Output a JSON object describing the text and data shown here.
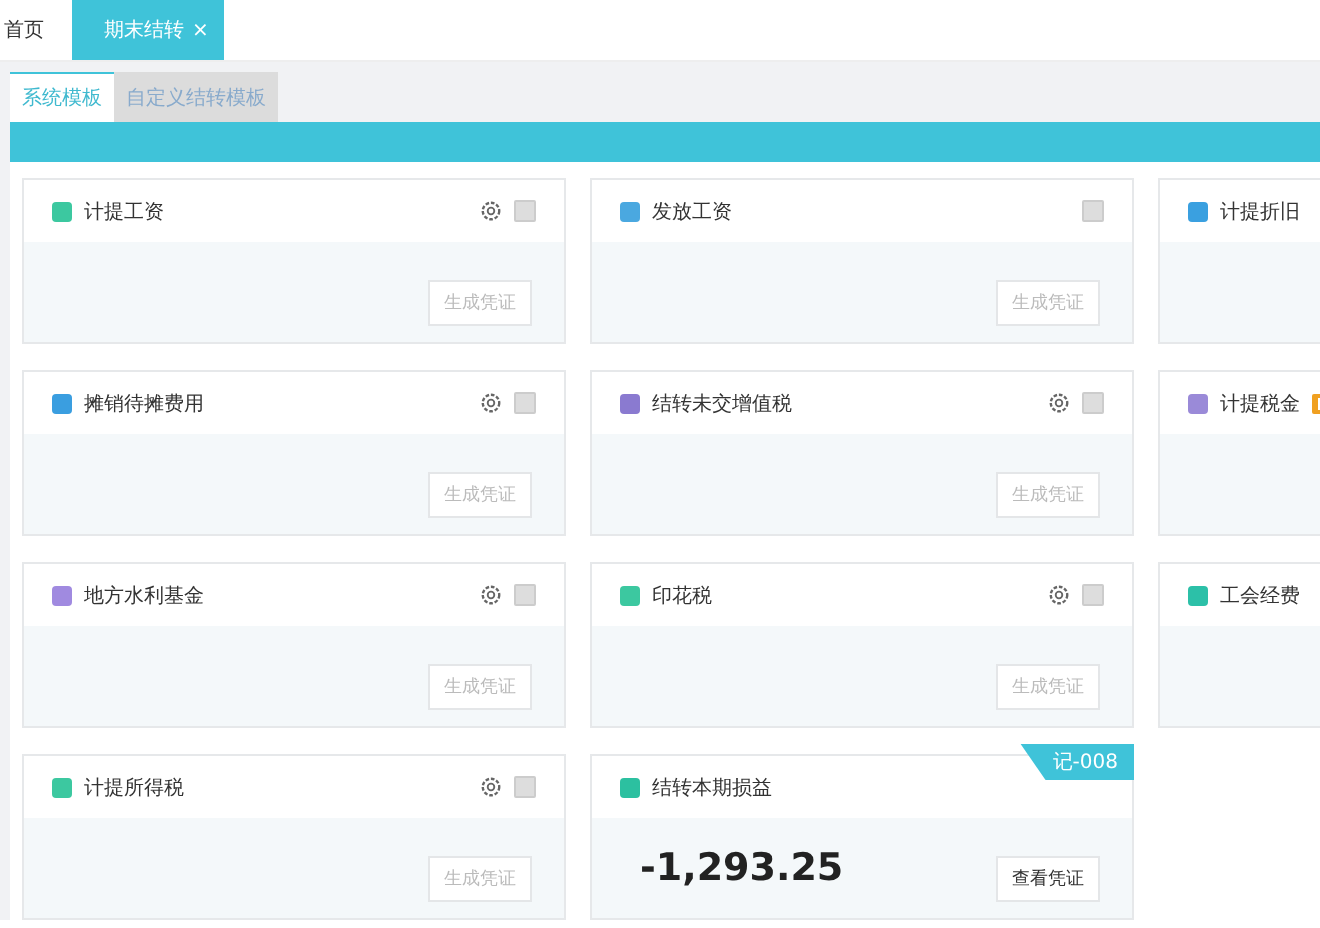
{
  "top_tabs": [
    {
      "label": "首页",
      "selected": false,
      "closable": false
    },
    {
      "label": "期末结转",
      "selected": true,
      "closable": true,
      "close": "×"
    }
  ],
  "sub_tabs": [
    {
      "label": "系统模板",
      "selected": true
    },
    {
      "label": "自定义结转模板",
      "selected": false
    }
  ],
  "card_rows": [
    [
      {
        "kind": "template",
        "title": "计提工资",
        "color": "#3cc8a0",
        "settings": true,
        "checked": false,
        "button": "生成凭证"
      },
      {
        "kind": "template",
        "title": "发放工资",
        "color": "#4aa8e0",
        "settings": false,
        "checked": false,
        "button": "生成凭证"
      },
      {
        "kind": "template",
        "title": "计提折旧",
        "color": "#3aa0e0"
      }
    ],
    [
      {
        "kind": "template",
        "title": "摊销待摊费用",
        "color": "#3a9ee0",
        "settings": true,
        "checked": false,
        "button": "生成凭证"
      },
      {
        "kind": "template",
        "title": "结转未交增值税",
        "color": "#8a7ad0",
        "settings": true,
        "checked": false,
        "button": "生成凭证"
      },
      {
        "kind": "template",
        "title": "计提税金",
        "color": "#9a8ad8",
        "badge": true
      }
    ],
    [
      {
        "kind": "template",
        "title": "地方水利基金",
        "color": "#a08ae0",
        "settings": true,
        "checked": false,
        "button": "生成凭证"
      },
      {
        "kind": "template",
        "title": "印花税",
        "color": "#3cc8a0",
        "settings": true,
        "checked": false,
        "button": "生成凭证"
      },
      {
        "kind": "template",
        "title": "工会经费",
        "color": "#2cc0a8"
      }
    ],
    [
      {
        "kind": "template",
        "title": "计提所得税",
        "color": "#3cc8a0",
        "settings": true,
        "checked": false,
        "button": "生成凭证"
      },
      {
        "kind": "result",
        "title": "结转本期损益",
        "color": "#2cc0a0",
        "amount": "-1,293.25",
        "button": "查看凭证",
        "voucher": "记-008"
      }
    ]
  ]
}
